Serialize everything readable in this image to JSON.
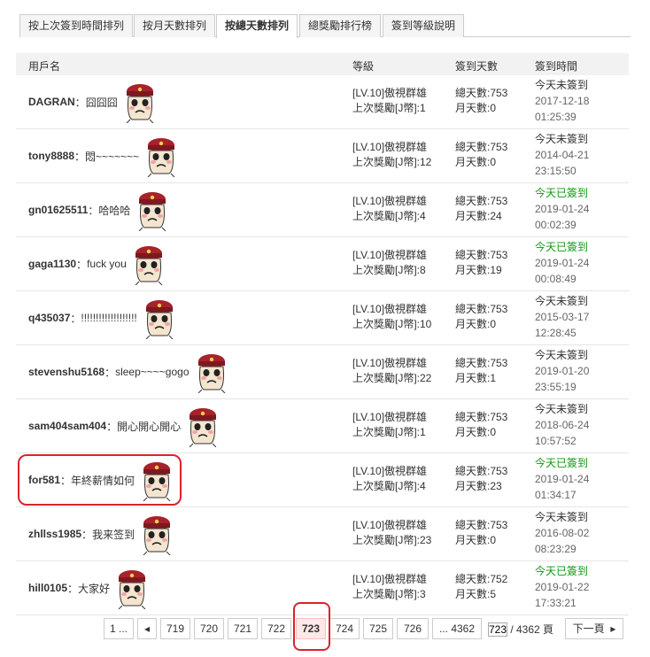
{
  "tabs": [
    "按上次簽到時間排列",
    "按月天數排列",
    "按總天數排列",
    "總獎勵排行榜",
    "簽到等級說明"
  ],
  "table": {
    "headers": {
      "user": "用戶名",
      "level": "等級",
      "days": "簽到天數",
      "time": "簽到時間"
    },
    "rows": [
      {
        "name": "DAGRAN",
        "colon": "：",
        "msg": "囧囧囧",
        "level": "[LV.10]傲視群雄",
        "reward": "上次獎勵[J幣]:1",
        "total": "總天數:753",
        "month": "月天數:0",
        "status": "今天未簽到",
        "status_color": "#333333",
        "date": "2017-12-18",
        "clock": "01:25:39",
        "avatar_icon": "mascot-face-icon"
      },
      {
        "name": "tony8888",
        "colon": "：",
        "msg": "悶~~~~~~~",
        "level": "[LV.10]傲視群雄",
        "reward": "上次獎勵[J幣]:12",
        "total": "總天數:753",
        "month": "月天數:0",
        "status": "今天未簽到",
        "status_color": "#333333",
        "date": "2014-04-21",
        "clock": "23:15:50",
        "avatar_icon": "mascot-face-icon"
      },
      {
        "name": "gn01625511",
        "colon": "：",
        "msg": "哈哈哈",
        "level": "[LV.10]傲視群雄",
        "reward": "上次獎勵[J幣]:4",
        "total": "總天數:753",
        "month": "月天數:24",
        "status": "今天已簽到",
        "status_color": "#119911",
        "date": "2019-01-24",
        "clock": "00:02:39",
        "avatar_icon": "mascot-face-icon"
      },
      {
        "name": "gaga1130",
        "colon": "：",
        "msg": "fuck you",
        "level": "[LV.10]傲視群雄",
        "reward": "上次獎勵[J幣]:8",
        "total": "總天數:753",
        "month": "月天數:19",
        "status": "今天已簽到",
        "status_color": "#119911",
        "date": "2019-01-24",
        "clock": "00:08:49",
        "avatar_icon": "mascot-face-icon"
      },
      {
        "name": "q435037",
        "colon": "：",
        "msg": "!!!!!!!!!!!!!!!!!!!",
        "level": "[LV.10]傲視群雄",
        "reward": "上次獎勵[J幣]:10",
        "total": "總天數:753",
        "month": "月天數:0",
        "status": "今天未簽到",
        "status_color": "#333333",
        "date": "2015-03-17",
        "clock": "12:28:45",
        "avatar_icon": "mascot-face-icon"
      },
      {
        "name": "stevenshu5168",
        "colon": "：",
        "msg": "sleep~~~~gogo",
        "level": "[LV.10]傲視群雄",
        "reward": "上次獎勵[J幣]:22",
        "total": "總天數:753",
        "month": "月天數:1",
        "status": "今天未簽到",
        "status_color": "#333333",
        "date": "2019-01-20",
        "clock": "23:55:19",
        "avatar_icon": "mascot-face-icon"
      },
      {
        "name": "sam404sam404",
        "colon": "：",
        "msg": "開心開心開心",
        "level": "[LV.10]傲視群雄",
        "reward": "上次獎勵[J幣]:1",
        "total": "總天數:753",
        "month": "月天數:0",
        "status": "今天未簽到",
        "status_color": "#333333",
        "date": "2018-06-24",
        "clock": "10:57:52",
        "avatar_icon": "mascot-face-icon"
      },
      {
        "name": "for581",
        "colon": "：",
        "msg": "年終薪情如何",
        "level": "[LV.10]傲視群雄",
        "reward": "上次獎勵[J幣]:4",
        "total": "總天數:753",
        "month": "月天數:23",
        "status": "今天已簽到",
        "status_color": "#119911",
        "date": "2019-01-24",
        "clock": "01:34:17",
        "avatar_icon": "mascot-face-icon"
      },
      {
        "name": "zhllss1985",
        "colon": "：",
        "msg": "我来签到",
        "level": "[LV.10]傲視群雄",
        "reward": "上次獎勵[J幣]:23",
        "total": "總天數:753",
        "month": "月天數:0",
        "status": "今天未簽到",
        "status_color": "#333333",
        "date": "2016-08-02",
        "clock": "08:23:29",
        "avatar_icon": "mascot-face-icon"
      },
      {
        "name": "hill0105",
        "colon": "：",
        "msg": "大家好",
        "level": "[LV.10]傲視群雄",
        "reward": "上次獎勵[J幣]:3",
        "total": "總天數:752",
        "month": "月天數:5",
        "status": "今天已簽到",
        "status_color": "#119911",
        "date": "2019-01-22",
        "clock": "17:33:21",
        "avatar_icon": "mascot-face-icon"
      }
    ]
  },
  "pagination": {
    "first": "1 ...",
    "pages": [
      "719",
      "720",
      "721",
      "722",
      "723",
      "724",
      "725",
      "726"
    ],
    "current": "723",
    "last": "... 4362",
    "input_value": "723",
    "total_text": " / 4362 頁",
    "next": "下一頁"
  },
  "colors": {
    "highlight": "#d9232d",
    "signed": "#119911",
    "current_page_bg": "#ffe8e8"
  }
}
